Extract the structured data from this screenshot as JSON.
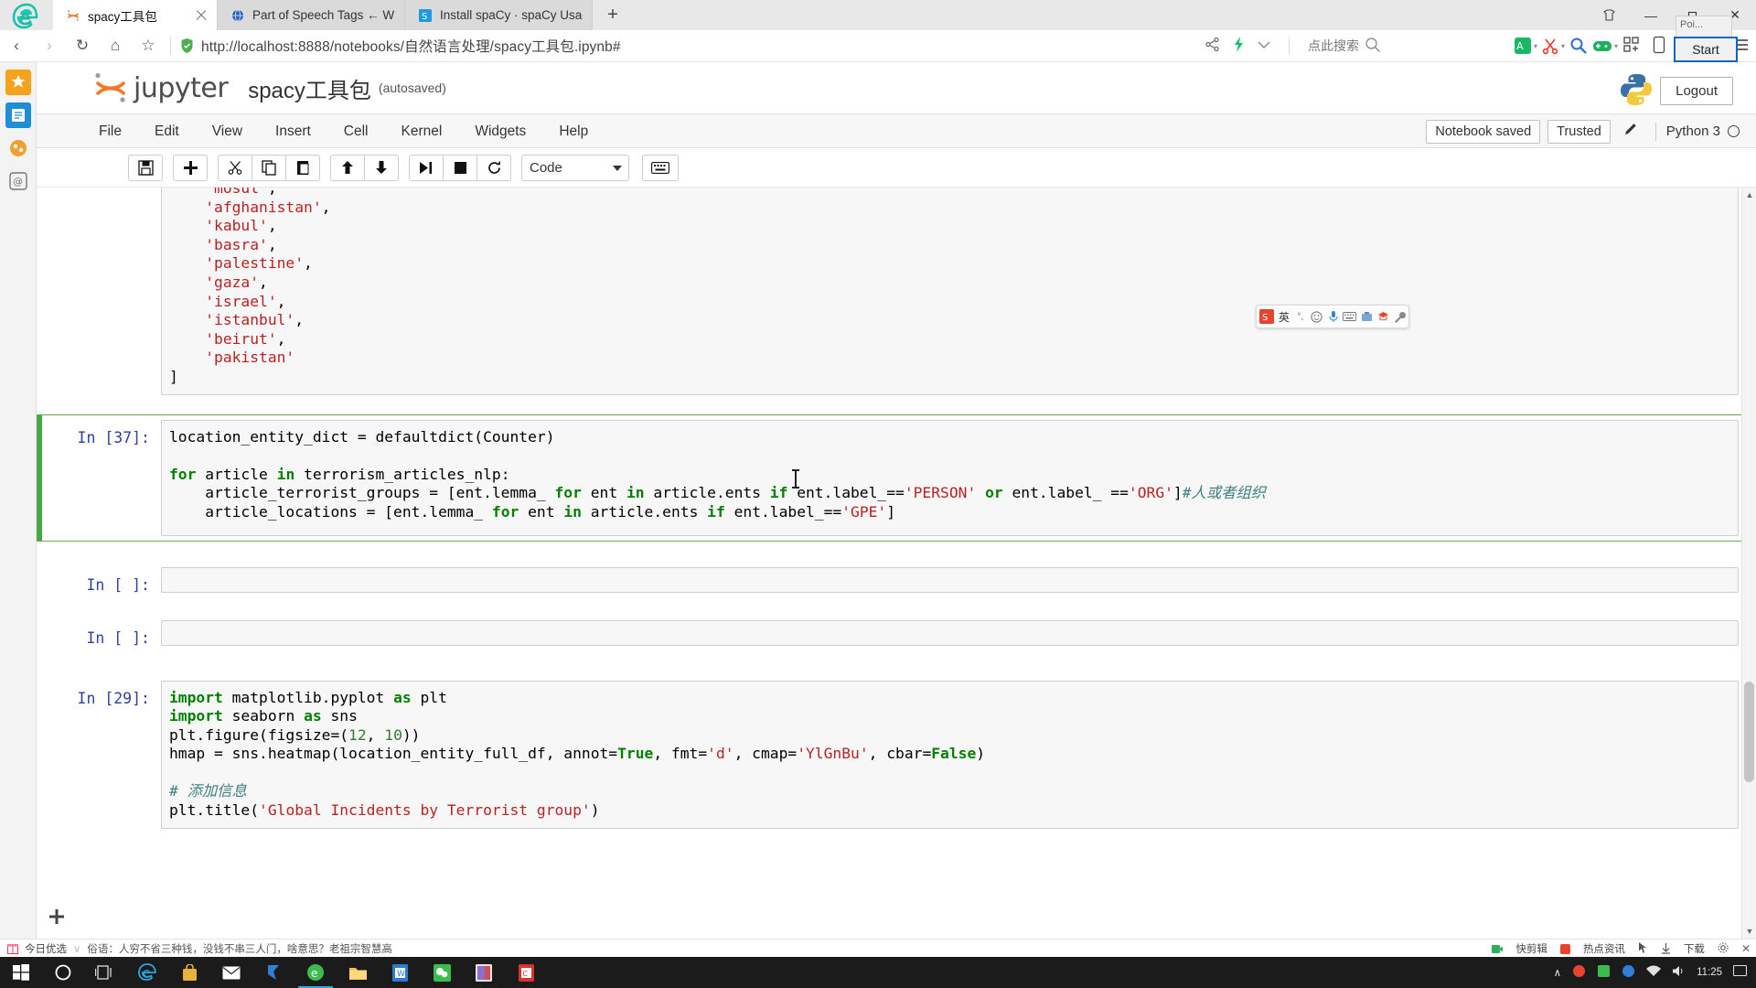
{
  "browser": {
    "tabs": [
      {
        "title": "spacy工具包",
        "favicon": "jupyter-icon",
        "active": true
      },
      {
        "title": "Part of Speech Tags ← Winw",
        "favicon": "globe-icon",
        "active": false
      },
      {
        "title": "Install spaCy · spaCy Usage D",
        "favicon": "spacy-icon",
        "active": false
      }
    ],
    "newtab_label": "+",
    "url_prefix": "http://",
    "url_host": "localhost",
    "url_rest": ":8888/notebooks/自然语言处理/spacy工具包.ipynb#",
    "url_full": "http://localhost:8888/notebooks/自然语言处理/spacy工具包.ipynb#",
    "search_placeholder": "点此搜索",
    "window_controls": {
      "minimize": "—",
      "maximize": "▢",
      "close": "✕"
    },
    "tooltip": "Poi...",
    "start_button": "Start"
  },
  "jupyter": {
    "logo_text": "jupyter",
    "notebook_title": "spacy工具包",
    "autosave_label": "(autosaved)",
    "logout_label": "Logout",
    "menus": [
      "File",
      "Edit",
      "View",
      "Insert",
      "Cell",
      "Kernel",
      "Widgets",
      "Help"
    ],
    "status": {
      "notebook_saved": "Notebook saved",
      "trusted": "Trusted",
      "kernel_name": "Python 3"
    },
    "toolbar": {
      "save": "save-icon",
      "insert_below": "plus-icon",
      "cut": "scissors-icon",
      "copy": "copy-icon",
      "paste": "paste-icon",
      "move_up": "arrow-up-icon",
      "move_down": "arrow-down-icon",
      "run": "run-icon",
      "interrupt": "stop-icon",
      "restart": "restart-icon",
      "cell_type": "Code",
      "command_palette": "keyboard-icon"
    }
  },
  "cells": [
    {
      "prompt": "",
      "type": "code",
      "selected": false,
      "lines": [
        "    'mosul',",
        "    'afghanistan',",
        "    'kabul',",
        "    'basra',",
        "    'palestine',",
        "    'gaza',",
        "    'israel',",
        "    'istanbul',",
        "    'beirut',",
        "    'pakistan'",
        "]"
      ]
    },
    {
      "prompt": "In [37]:",
      "type": "code",
      "selected": true,
      "lines": [
        "location_entity_dict = defaultdict(Counter)",
        "",
        "for article in terrorism_articles_nlp:",
        "    article_terrorist_groups = [ent.lemma_ for ent in article.ents if ent.label_=='PERSON' or ent.label_ =='ORG']#人或者组织",
        "    article_locations = [ent.lemma_ for ent in article.ents if ent.label_=='GPE']"
      ]
    },
    {
      "prompt": "In [ ]:",
      "type": "code",
      "selected": false,
      "lines": [
        ""
      ]
    },
    {
      "prompt": "In [ ]:",
      "type": "code",
      "selected": false,
      "lines": [
        ""
      ]
    },
    {
      "prompt": "In [29]:",
      "type": "code",
      "selected": false,
      "lines": [
        "import matplotlib.pyplot as plt",
        "import seaborn as sns",
        "plt.figure(figsize=(12, 10))",
        "hmap = sns.heatmap(location_entity_full_df, annot=True, fmt='d', cmap='YlGnBu', cbar=False)",
        "",
        "# 添加信息",
        "plt.title('Global Incidents by Terrorist group')"
      ]
    }
  ],
  "ime": {
    "logo": "sogou-icon",
    "mode": "英",
    "items": [
      "英",
      "•,",
      "smiley-icon",
      "mic-icon",
      "keyboard-icon",
      "tools-icon",
      "hat-icon",
      "wrench-icon"
    ]
  },
  "newsbar": {
    "left_label": "今日优选",
    "headline": "俗语：人穷不省三种钱，没钱不串三人门，啥意思？老祖宗智慧高",
    "right_items": [
      "快剪辑",
      "热点资讯",
      "下载"
    ]
  },
  "taskbar": {
    "clock_time": "11:25",
    "clock_date": "",
    "items": [
      "start-icon",
      "cortana-icon",
      "taskview-icon",
      "edge-icon",
      "store-icon",
      "mail-icon",
      "foxmail-icon",
      "sogou-browser-icon",
      "explorer-icon",
      "word-icon",
      "wechat-icon",
      "notepad-icon",
      "pdf-icon"
    ]
  },
  "colors": {
    "accent_green": "#42a948",
    "jupyter_orange": "#f37726",
    "prompt_blue": "#303f9f",
    "string_red": "#ba2121",
    "keyword_green": "#008000",
    "comment_teal": "#408080"
  }
}
